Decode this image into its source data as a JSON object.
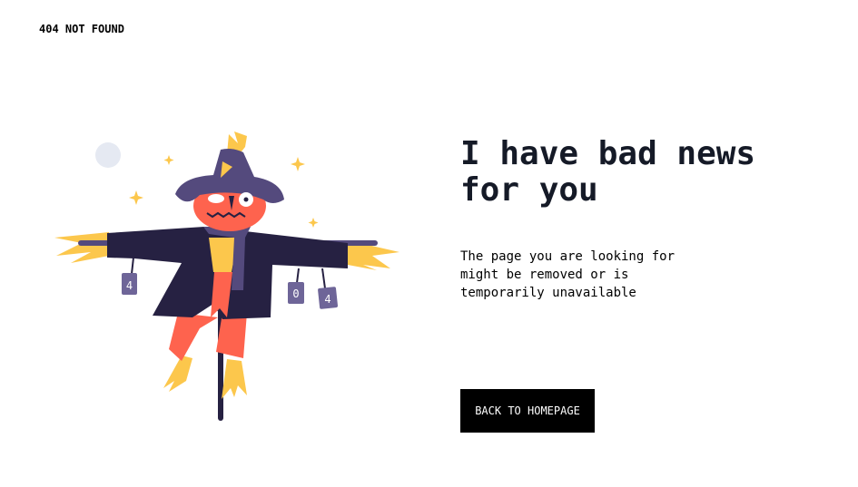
{
  "header": {
    "brand": "404 NOT FOUND"
  },
  "illustration": {
    "cans": [
      "4",
      "0",
      "4"
    ]
  },
  "main": {
    "title": "I have bad news for you",
    "description": "The page you are looking for might be removed or is temporarily unavailable",
    "button_label": "BACK TO HOMEPAGE"
  },
  "colors": {
    "button_bg": "#000000",
    "title": "#151a27",
    "coat": "#262142",
    "hat": "#544a7d",
    "head": "#fe634e",
    "straw": "#fcc74c"
  }
}
